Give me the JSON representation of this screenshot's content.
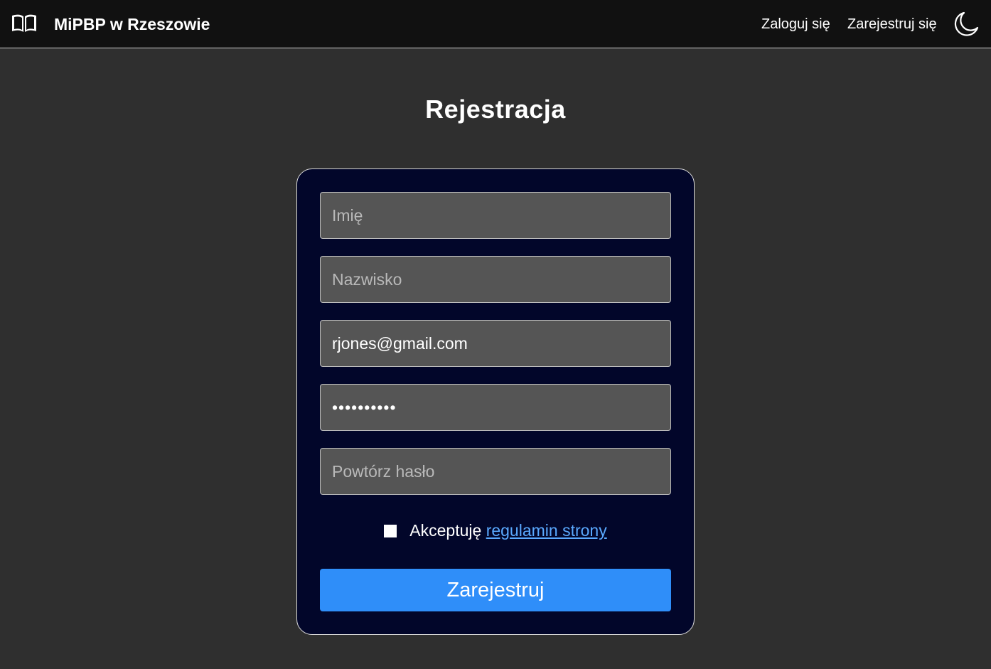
{
  "header": {
    "brand_icon": "open-book-icon",
    "brand_name": "MiPBP w Rzeszowie",
    "login_label": "Zaloguj się",
    "register_label": "Zarejestruj się",
    "theme_icon": "moon-icon"
  },
  "main": {
    "title": "Rejestracja"
  },
  "form": {
    "first_name": {
      "placeholder": "Imię",
      "value": ""
    },
    "last_name": {
      "placeholder": "Nazwisko",
      "value": ""
    },
    "email": {
      "placeholder": "",
      "value": "rjones@gmail.com"
    },
    "password": {
      "placeholder": "",
      "value": "••••••••••"
    },
    "repeat_password": {
      "placeholder": "Powtórz hasło",
      "value": ""
    },
    "terms_prefix": "Akceptuję",
    "terms_link": "regulamin strony",
    "terms_checked": false,
    "submit_label": "Zarejestruj"
  },
  "colors": {
    "page_background": "#2f2f2f",
    "navbar_background": "#111111",
    "card_background": "#02062a",
    "input_background": "#555555",
    "accent": "#2f8ef9",
    "link": "#5aa9ff"
  }
}
